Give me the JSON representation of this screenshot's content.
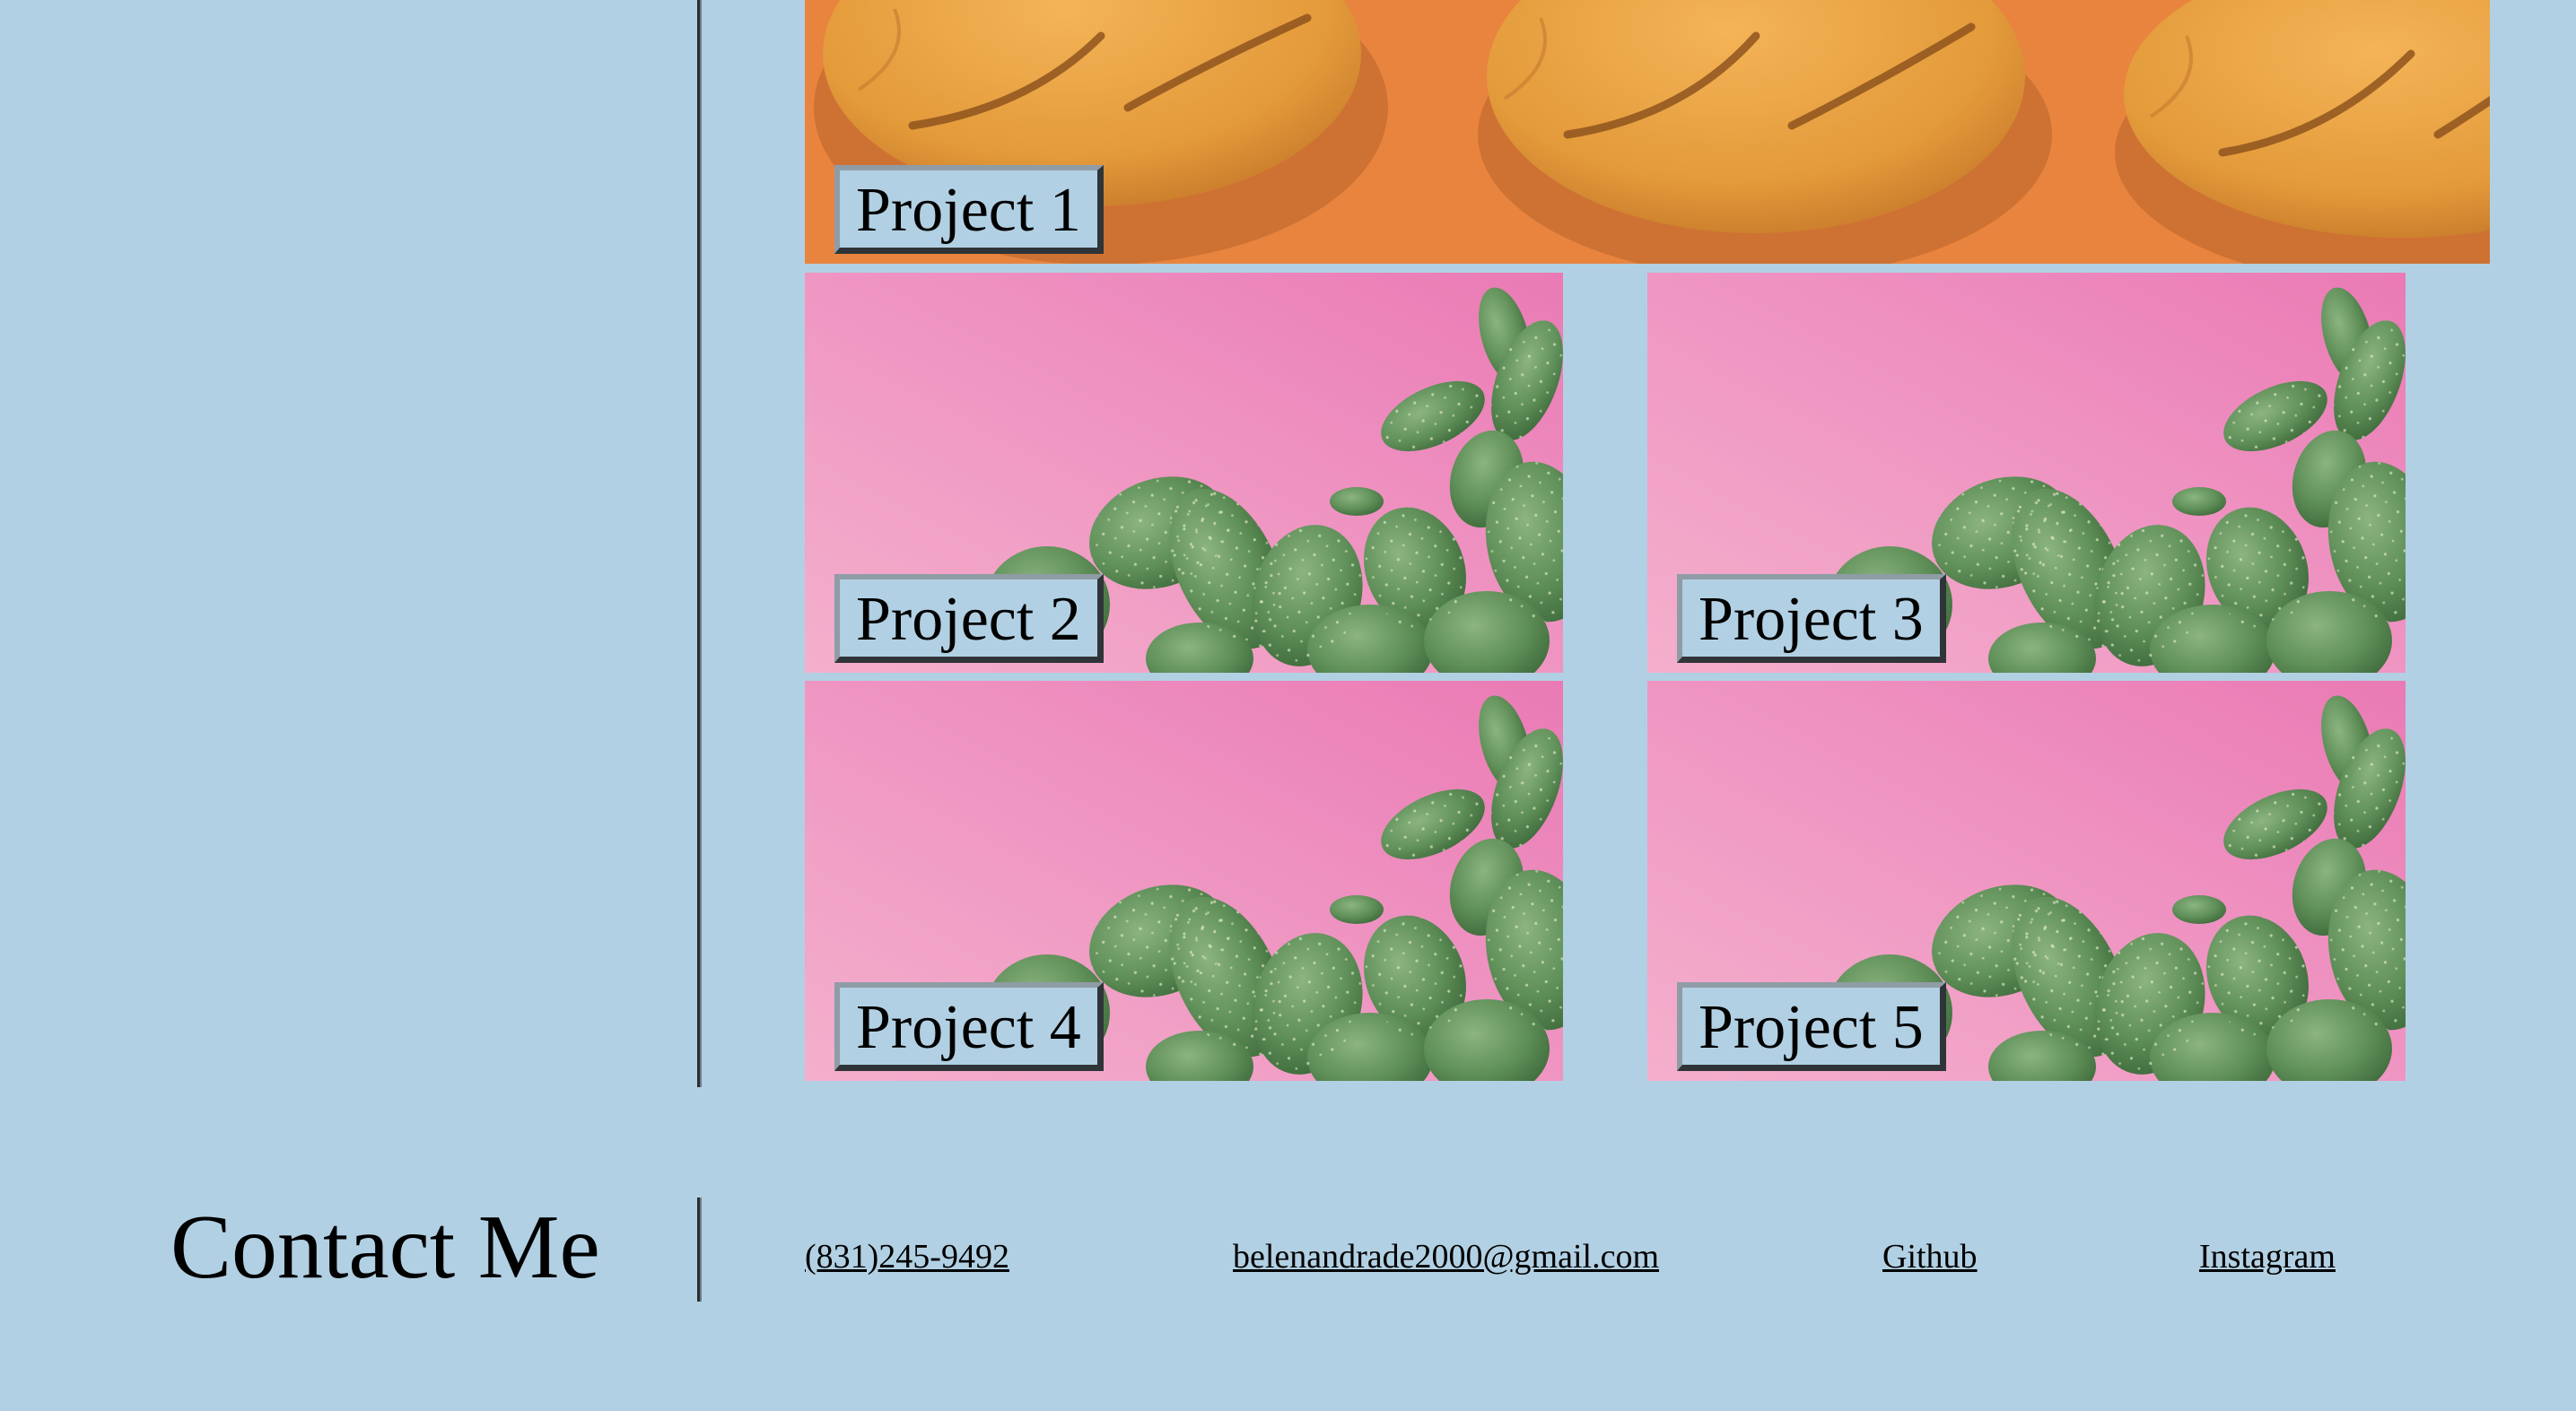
{
  "projects": [
    {
      "label": "Project 1",
      "image": "bread-rolls-on-orange"
    },
    {
      "label": "Project 2",
      "image": "cactus-on-pink"
    },
    {
      "label": "Project 3",
      "image": "cactus-on-pink"
    },
    {
      "label": "Project 4",
      "image": "cactus-on-pink"
    },
    {
      "label": "Project 5",
      "image": "cactus-on-pink"
    }
  ],
  "contact": {
    "title": "Contact Me",
    "phone": "(831)245-9492",
    "email": "belenandrade2000@gmail.com",
    "github": "Github",
    "instagram": "Instagram"
  },
  "colors": {
    "background": "#b2d0e3",
    "divider": "#2d2d2d",
    "bread_bg": "#e8843e",
    "pink_bg": "#ee8fbe",
    "cactus": "#5d8f57"
  }
}
